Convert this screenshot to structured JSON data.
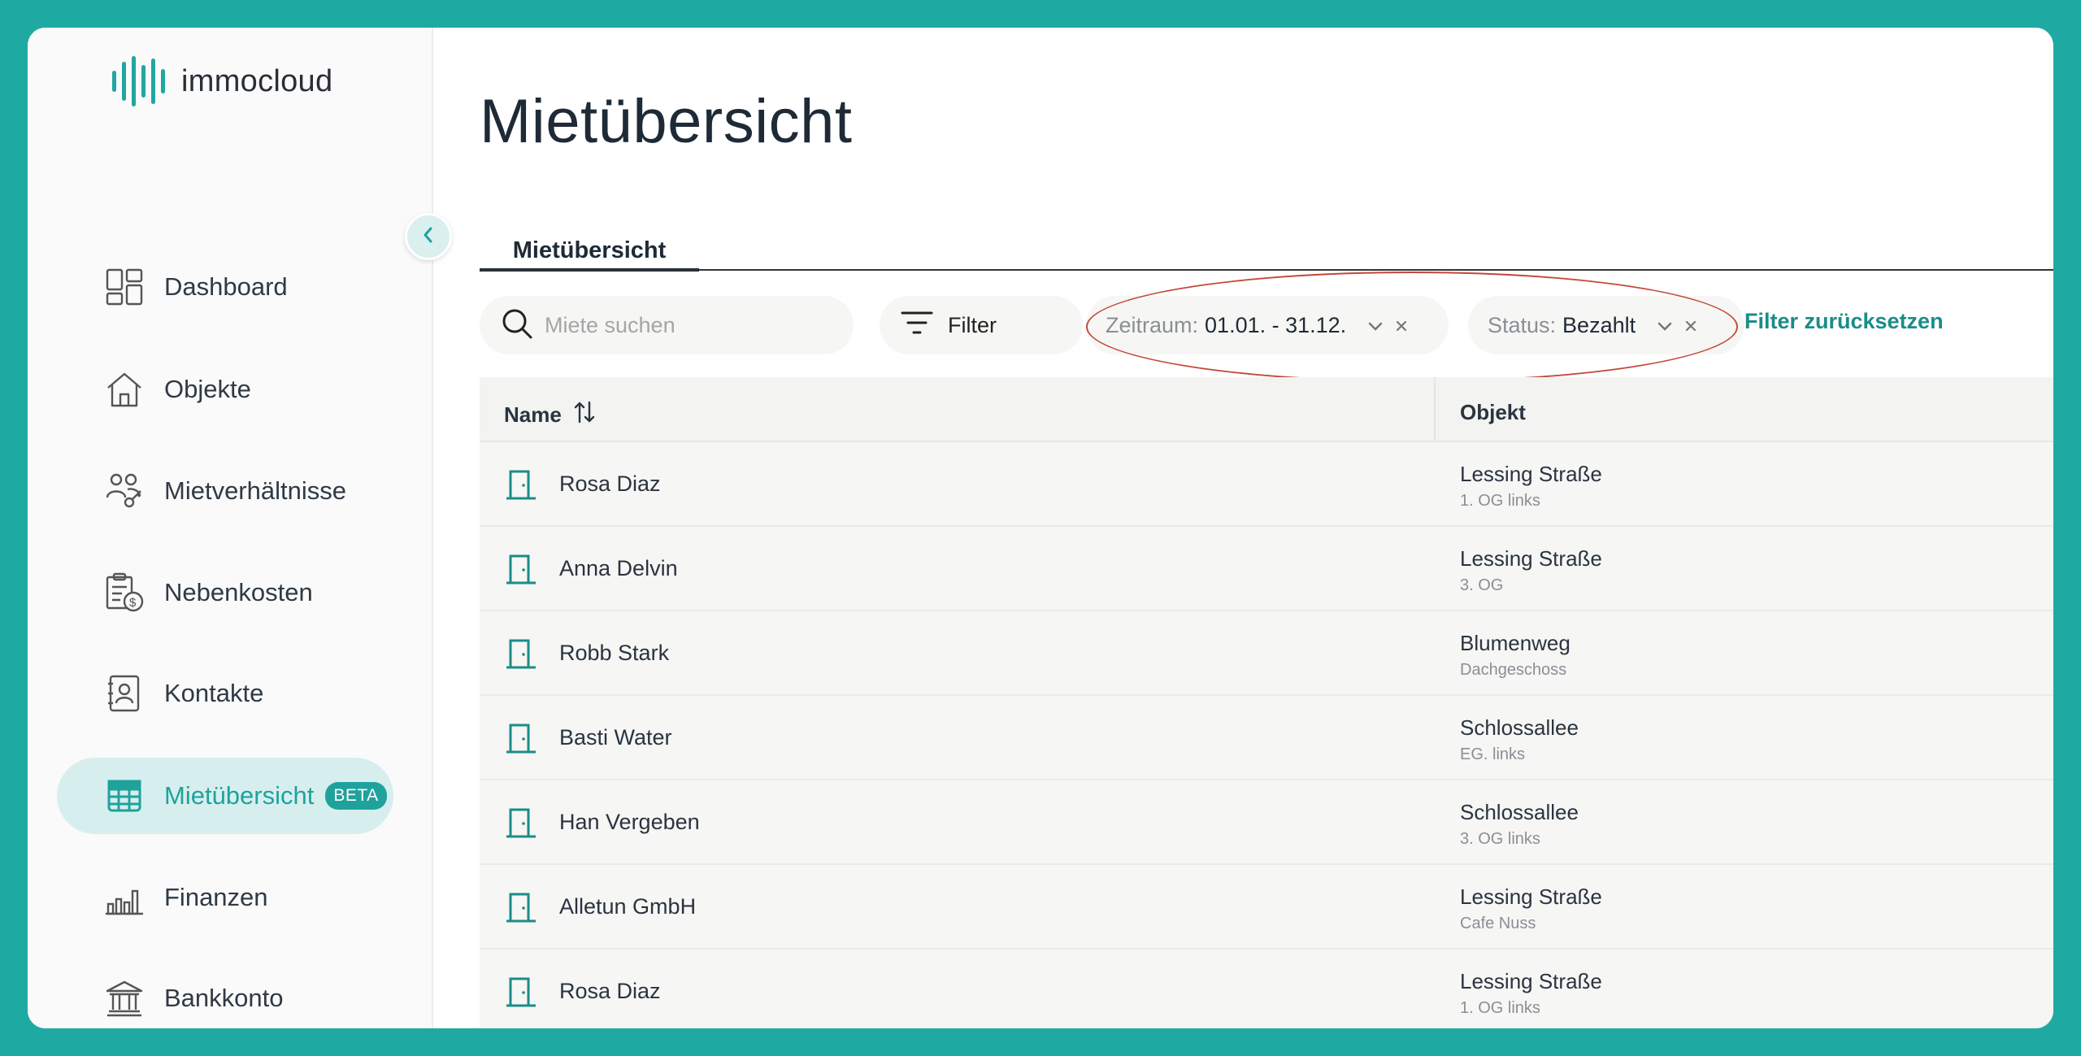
{
  "app": {
    "logo_text": "immocloud"
  },
  "sidebar": {
    "items": [
      {
        "label": "Dashboard",
        "icon": "dashboard-icon"
      },
      {
        "label": "Objekte",
        "icon": "house-icon"
      },
      {
        "label": "Mietverhältnisse",
        "icon": "tenants-key-icon"
      },
      {
        "label": "Nebenkosten",
        "icon": "receipt-coin-icon"
      },
      {
        "label": "Kontakte",
        "icon": "contact-card-icon"
      },
      {
        "label": "Mietübersicht",
        "icon": "calendar-grid-icon",
        "badge": "BETA",
        "active": true
      },
      {
        "label": "Finanzen",
        "icon": "bar-chart-icon"
      },
      {
        "label": "Bankkonto",
        "icon": "bank-icon"
      }
    ]
  },
  "main": {
    "title": "Mietübersicht",
    "tab": "Mietübersicht",
    "search_placeholder": "Miete suchen",
    "filter_label": "Filter",
    "chips": [
      {
        "key": "Zeitraum:",
        "value": "01.01. - 31.12."
      },
      {
        "key": "Status:",
        "value": "Bezahlt"
      }
    ],
    "reset_label": "Filter zurücksetzen"
  },
  "table": {
    "columns": [
      "Name",
      "Objekt"
    ],
    "rows": [
      {
        "name": "Rosa Diaz",
        "object": "Lessing Straße",
        "unit": "1. OG links"
      },
      {
        "name": "Anna Delvin",
        "object": "Lessing Straße",
        "unit": "3. OG"
      },
      {
        "name": "Robb Stark",
        "object": "Blumenweg",
        "unit": "Dachgeschoss"
      },
      {
        "name": "Basti Water",
        "object": "Schlossallee",
        "unit": "EG. links"
      },
      {
        "name": "Han Vergeben",
        "object": "Schlossallee",
        "unit": "3. OG links"
      },
      {
        "name": "Alletun GmbH",
        "object": "Lessing Straße",
        "unit": "Cafe Nuss"
      },
      {
        "name": "Rosa Diaz",
        "object": "Lessing Straße",
        "unit": "1. OG links"
      }
    ]
  },
  "colors": {
    "accent": "#1fa29c",
    "background": "#1fa9a3",
    "annotation": "#c2483a"
  }
}
